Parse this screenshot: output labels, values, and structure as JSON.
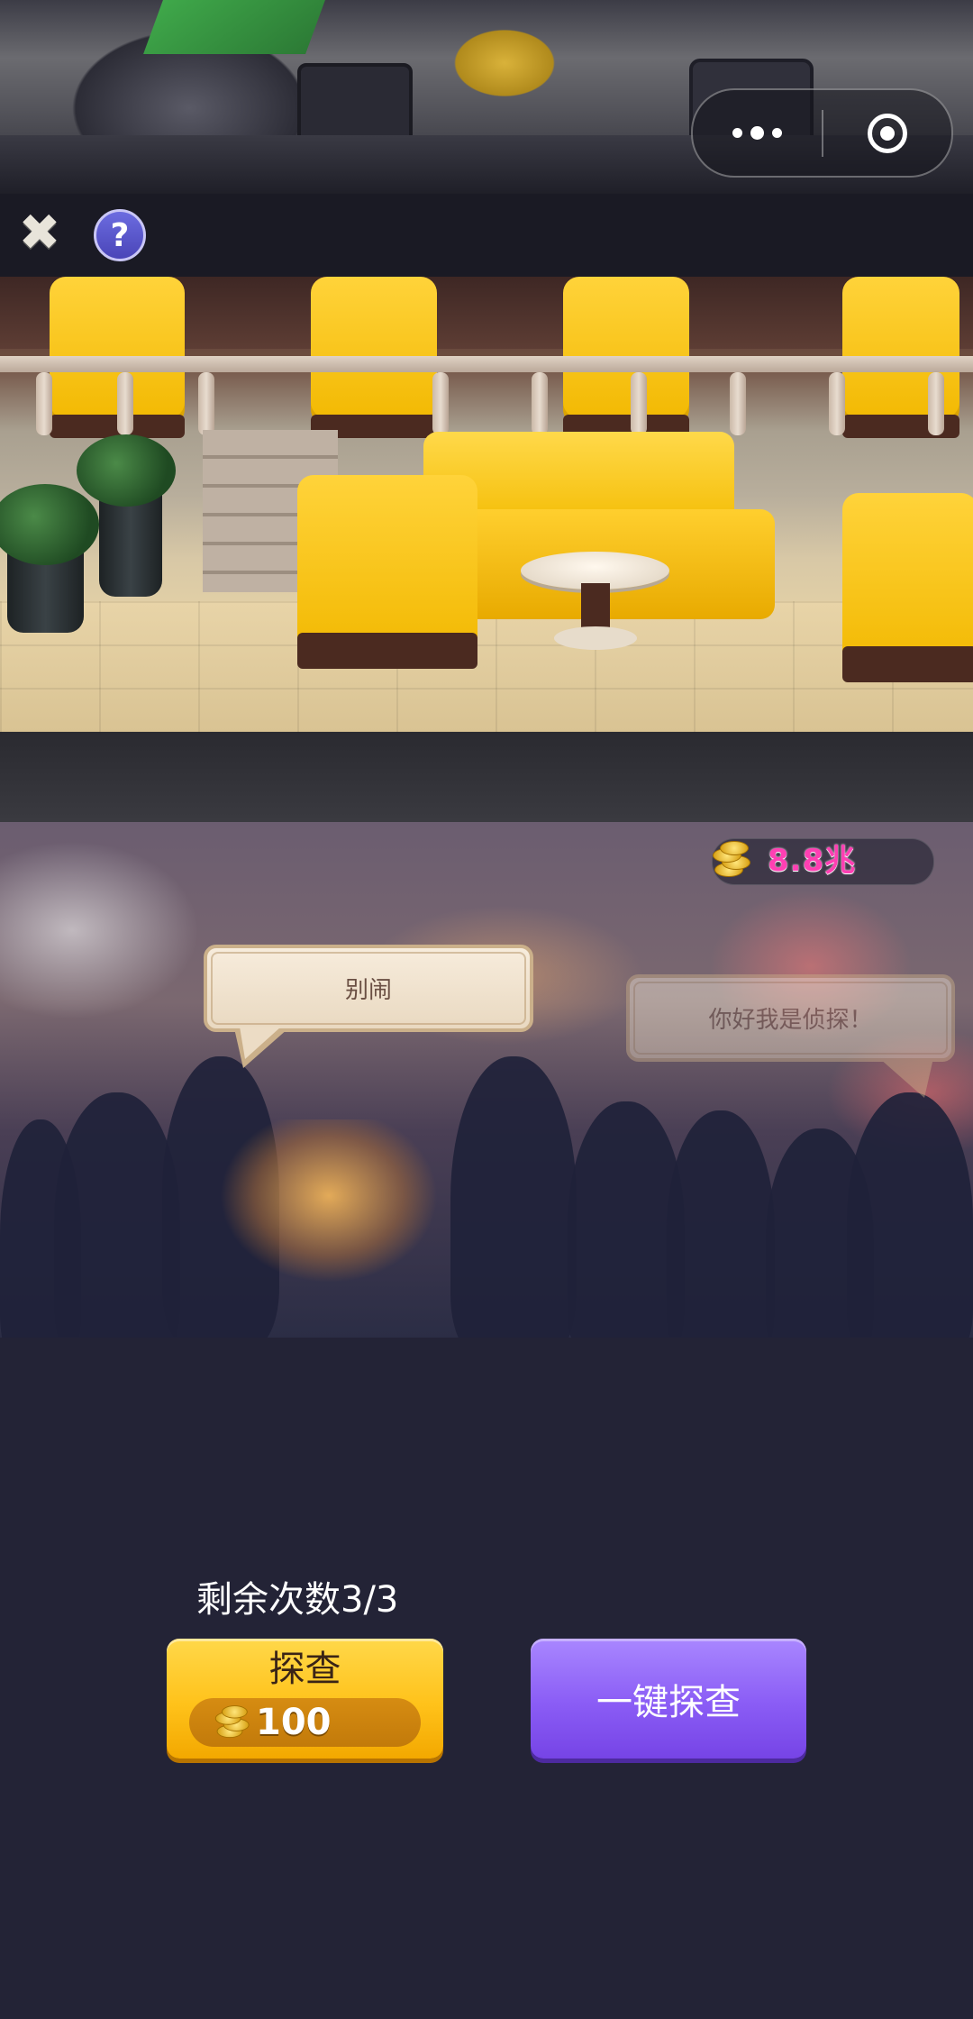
{
  "capsule": {
    "more_icon": "more-dots-icon",
    "close_icon": "target-circle-icon"
  },
  "toolbar": {
    "close_icon": "close-x-icon",
    "help_label": "?"
  },
  "currency": {
    "icon": "gold-coins-icon",
    "value": "8.8兆"
  },
  "dialogue": {
    "left_bubble": "别闹",
    "right_bubble": "你好我是侦探！"
  },
  "controls": {
    "remaining_text": "剩余次数3/3",
    "probe_button": {
      "label": "探查",
      "cost_icon": "gold-coins-icon",
      "cost": "100"
    },
    "onekey_button": {
      "label": "一键探查"
    }
  },
  "colors": {
    "background": "#232336",
    "probe_button": "#ffc21a",
    "onekey_button": "#8a5cf5",
    "currency_text": "#ff3fb3"
  }
}
